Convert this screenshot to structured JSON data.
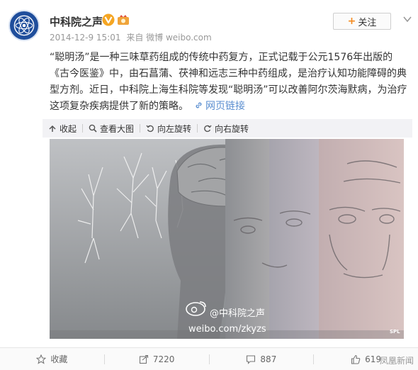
{
  "account": {
    "name": "中科院之声",
    "date": "2014-12-9 15:01",
    "source": "来自 微博 weibo.com",
    "follow_label": "关注"
  },
  "post": {
    "text": "“聪明汤”是一种三味草药组成的传统中药复方，正式记载于公元1576年出版的《古今医鉴》中，由石菖蒲、茯神和远志三种中药组成，是治疗认知功能障碍的典型方剂。近日，中科院上海生科院等发现“聪明汤”可以改善阿尔茨海默病，为治疗这项复杂疾病提供了新的策略。",
    "link_label": "网页链接"
  },
  "media_toolbar": {
    "collapse": "收起",
    "view_large": "查看大图",
    "rotate_left": "向左旋转",
    "rotate_right": "向右旋转"
  },
  "image": {
    "watermark_handle": "@中科院之声",
    "watermark_url": "weibo.com/zkyzs",
    "credit": "SPL"
  },
  "actions": {
    "favorite": "收藏",
    "repost": "7220",
    "comment": "887",
    "like": "619"
  },
  "corner_watermark": "凤凰新闻",
  "colors": {
    "link": "#5a8ed0",
    "accent_orange": "#f58a1f",
    "verified": "#f5a623"
  }
}
